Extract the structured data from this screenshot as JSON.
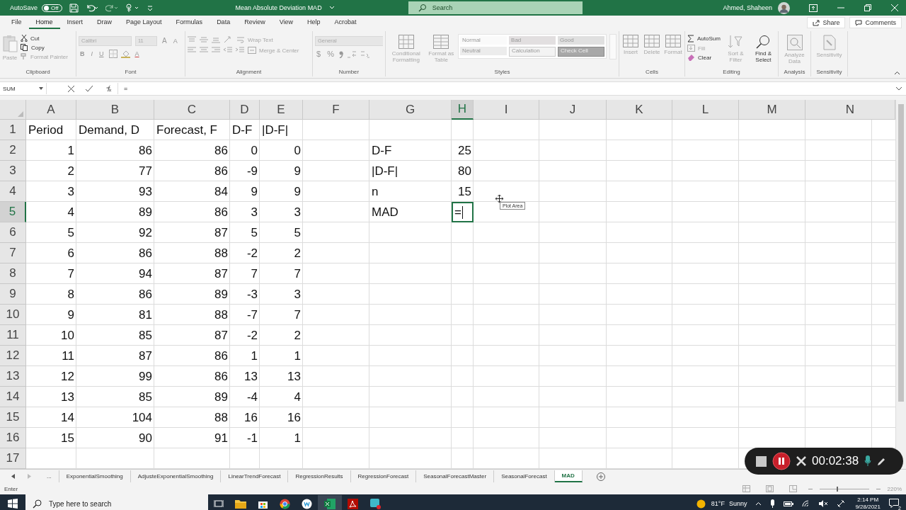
{
  "title_bar": {
    "autosave": {
      "label": "AutoSave",
      "on": false,
      "state_text": "Off"
    },
    "document_title": "Mean Absolute Deviation MAD",
    "search_placeholder": "Search",
    "user_name": "Ahmed, Shaheen"
  },
  "menu_tabs": [
    {
      "label": "File",
      "selected": false
    },
    {
      "label": "Home",
      "selected": true
    },
    {
      "label": "Insert",
      "selected": false
    },
    {
      "label": "Draw",
      "selected": false
    },
    {
      "label": "Page Layout",
      "selected": false
    },
    {
      "label": "Formulas",
      "selected": false
    },
    {
      "label": "Data",
      "selected": false
    },
    {
      "label": "Review",
      "selected": false
    },
    {
      "label": "View",
      "selected": false
    },
    {
      "label": "Help",
      "selected": false
    },
    {
      "label": "Acrobat",
      "selected": false
    }
  ],
  "share": "Share",
  "comments": "Comments",
  "ribbon": {
    "clipboard": {
      "label": "Clipboard",
      "paste": "Paste",
      "cut": "Cut",
      "copy": "Copy",
      "format_painter": "Format Painter"
    },
    "font": {
      "label": "Font",
      "font_name": "Calibri",
      "font_size": "11",
      "size_glyphs": [
        "A",
        "A"
      ],
      "format_glyphs": [
        "B",
        "I",
        "U"
      ],
      "font_color_glyph": "A"
    },
    "alignment": {
      "label": "Alignment",
      "wrap_text": "Wrap Text",
      "merge_center": "Merge & Center"
    },
    "number": {
      "label": "Number",
      "format": "General",
      "symbols": [
        "$",
        "%"
      ]
    },
    "styles": {
      "label": "Styles",
      "conditional_formatting": "Conditional Formatting",
      "format_as_table": "Format as Table",
      "cell_styles": [
        {
          "label": "Normal",
          "kind": "normal"
        },
        {
          "label": "Bad",
          "kind": "bad"
        },
        {
          "label": "Good",
          "kind": "good"
        },
        {
          "label": "Neutral",
          "kind": "neutral"
        },
        {
          "label": "Calculation",
          "kind": "calculation"
        },
        {
          "label": "Check Cell",
          "kind": "check"
        }
      ]
    },
    "cells": {
      "label": "Cells",
      "buttons": [
        "Insert",
        "Delete",
        "Format"
      ]
    },
    "editing": {
      "label": "Editing",
      "autosum": "AutoSum",
      "fill": "Fill",
      "clear": "Clear",
      "sort_filter": "Sort & Filter",
      "find_select": "Find & Select"
    },
    "analysis": {
      "label": "Analysis",
      "button": "Analyze Data"
    },
    "sensitivity": {
      "label": "Sensitivity",
      "button": "Sensitivity"
    }
  },
  "formula_bar": {
    "name_box": "SUM",
    "formula": "="
  },
  "sheet": {
    "columns": [
      {
        "label": "A",
        "selected": false
      },
      {
        "label": "B",
        "selected": false
      },
      {
        "label": "C",
        "selected": false
      },
      {
        "label": "D",
        "selected": false
      },
      {
        "label": "E",
        "selected": false
      },
      {
        "label": "F",
        "selected": false
      },
      {
        "label": "G",
        "selected": false
      },
      {
        "label": "H",
        "selected": true
      },
      {
        "label": "I",
        "selected": false
      },
      {
        "label": "J",
        "selected": false
      },
      {
        "label": "K",
        "selected": false
      },
      {
        "label": "L",
        "selected": false
      },
      {
        "label": "M",
        "selected": false
      },
      {
        "label": "N",
        "selected": false
      }
    ],
    "rows": [
      {
        "label": "1",
        "selected": false,
        "cells": [
          {
            "text": "Period",
            "kind": "text"
          },
          {
            "text": "Demand, D",
            "kind": "text"
          },
          {
            "text": "Forecast, F",
            "kind": "text"
          },
          {
            "text": "D-F",
            "kind": "text"
          },
          {
            "text": "|D-F|",
            "kind": "text"
          }
        ]
      },
      {
        "label": "2",
        "selected": false,
        "cells": [
          {
            "text": "1",
            "kind": "number"
          },
          {
            "text": "86",
            "kind": "number"
          },
          {
            "text": "86",
            "kind": "number"
          },
          {
            "text": "0",
            "kind": "number"
          },
          {
            "text": "0",
            "kind": "number"
          },
          {},
          {
            "text": "D-F",
            "kind": "text"
          },
          {
            "text": "25",
            "kind": "number"
          }
        ]
      },
      {
        "label": "3",
        "selected": false,
        "cells": [
          {
            "text": "2",
            "kind": "number"
          },
          {
            "text": "77",
            "kind": "number"
          },
          {
            "text": "86",
            "kind": "number"
          },
          {
            "text": "-9",
            "kind": "number"
          },
          {
            "text": "9",
            "kind": "number"
          },
          {},
          {
            "text": "|D-F|",
            "kind": "text"
          },
          {
            "text": "80",
            "kind": "number"
          }
        ]
      },
      {
        "label": "4",
        "selected": false,
        "cells": [
          {
            "text": "3",
            "kind": "number"
          },
          {
            "text": "93",
            "kind": "number"
          },
          {
            "text": "84",
            "kind": "number"
          },
          {
            "text": "9",
            "kind": "number"
          },
          {
            "text": "9",
            "kind": "number"
          },
          {},
          {
            "text": "n",
            "kind": "text"
          },
          {
            "text": "15",
            "kind": "number"
          }
        ]
      },
      {
        "label": "5",
        "selected": true,
        "cells": [
          {
            "text": "4",
            "kind": "number"
          },
          {
            "text": "89",
            "kind": "number"
          },
          {
            "text": "86",
            "kind": "number"
          },
          {
            "text": "3",
            "kind": "number"
          },
          {
            "text": "3",
            "kind": "number"
          },
          {},
          {
            "text": "MAD",
            "kind": "text"
          },
          {
            "text": "=",
            "kind": "text",
            "active": true
          }
        ]
      },
      {
        "label": "6",
        "selected": false,
        "cells": [
          {
            "text": "5",
            "kind": "number"
          },
          {
            "text": "92",
            "kind": "number"
          },
          {
            "text": "87",
            "kind": "number"
          },
          {
            "text": "5",
            "kind": "number"
          },
          {
            "text": "5",
            "kind": "number"
          }
        ]
      },
      {
        "label": "7",
        "selected": false,
        "cells": [
          {
            "text": "6",
            "kind": "number"
          },
          {
            "text": "86",
            "kind": "number"
          },
          {
            "text": "88",
            "kind": "number"
          },
          {
            "text": "-2",
            "kind": "number"
          },
          {
            "text": "2",
            "kind": "number"
          }
        ]
      },
      {
        "label": "8",
        "selected": false,
        "cells": [
          {
            "text": "7",
            "kind": "number"
          },
          {
            "text": "94",
            "kind": "number"
          },
          {
            "text": "87",
            "kind": "number"
          },
          {
            "text": "7",
            "kind": "number"
          },
          {
            "text": "7",
            "kind": "number"
          }
        ]
      },
      {
        "label": "9",
        "selected": false,
        "cells": [
          {
            "text": "8",
            "kind": "number"
          },
          {
            "text": "86",
            "kind": "number"
          },
          {
            "text": "89",
            "kind": "number"
          },
          {
            "text": "-3",
            "kind": "number"
          },
          {
            "text": "3",
            "kind": "number"
          }
        ]
      },
      {
        "label": "10",
        "selected": false,
        "cells": [
          {
            "text": "9",
            "kind": "number"
          },
          {
            "text": "81",
            "kind": "number"
          },
          {
            "text": "88",
            "kind": "number"
          },
          {
            "text": "-7",
            "kind": "number"
          },
          {
            "text": "7",
            "kind": "number"
          }
        ]
      },
      {
        "label": "11",
        "selected": false,
        "cells": [
          {
            "text": "10",
            "kind": "number"
          },
          {
            "text": "85",
            "kind": "number"
          },
          {
            "text": "87",
            "kind": "number"
          },
          {
            "text": "-2",
            "kind": "number"
          },
          {
            "text": "2",
            "kind": "number"
          }
        ]
      },
      {
        "label": "12",
        "selected": false,
        "cells": [
          {
            "text": "11",
            "kind": "number"
          },
          {
            "text": "87",
            "kind": "number"
          },
          {
            "text": "86",
            "kind": "number"
          },
          {
            "text": "1",
            "kind": "number"
          },
          {
            "text": "1",
            "kind": "number"
          }
        ]
      },
      {
        "label": "13",
        "selected": false,
        "cells": [
          {
            "text": "12",
            "kind": "number"
          },
          {
            "text": "99",
            "kind": "number"
          },
          {
            "text": "86",
            "kind": "number"
          },
          {
            "text": "13",
            "kind": "number"
          },
          {
            "text": "13",
            "kind": "number"
          }
        ]
      },
      {
        "label": "14",
        "selected": false,
        "cells": [
          {
            "text": "13",
            "kind": "number"
          },
          {
            "text": "85",
            "kind": "number"
          },
          {
            "text": "89",
            "kind": "number"
          },
          {
            "text": "-4",
            "kind": "number"
          },
          {
            "text": "4",
            "kind": "number"
          }
        ]
      },
      {
        "label": "15",
        "selected": false,
        "cells": [
          {
            "text": "14",
            "kind": "number"
          },
          {
            "text": "104",
            "kind": "number"
          },
          {
            "text": "88",
            "kind": "number"
          },
          {
            "text": "16",
            "kind": "number"
          },
          {
            "text": "16",
            "kind": "number"
          }
        ]
      },
      {
        "label": "16",
        "selected": false,
        "cells": [
          {
            "text": "15",
            "kind": "number"
          },
          {
            "text": "90",
            "kind": "number"
          },
          {
            "text": "91",
            "kind": "number"
          },
          {
            "text": "-1",
            "kind": "number"
          },
          {
            "text": "1",
            "kind": "number"
          }
        ]
      },
      {
        "label": "17",
        "selected": false,
        "cells": []
      }
    ]
  },
  "tooltip": "Plot Area",
  "sheet_tabs": {
    "overflow": "...",
    "tabs": [
      {
        "label": "ExponentialSmoothing",
        "selected": false
      },
      {
        "label": "AdjusteExponentialSmoothing",
        "selected": false
      },
      {
        "label": "LinearTrendForecast",
        "selected": false
      },
      {
        "label": "RegressionResults",
        "selected": false
      },
      {
        "label": "RegressionForecast",
        "selected": false
      },
      {
        "label": "SeasonalForecastMaster",
        "selected": false
      },
      {
        "label": "SeasonalForecast",
        "selected": false
      },
      {
        "label": "MAD",
        "selected": true
      }
    ]
  },
  "status_bar": {
    "mode": "Enter",
    "zoom": {
      "level": 0.35,
      "reading": "220%"
    }
  },
  "recorder": {
    "time": "00:02:38"
  },
  "taskbar": {
    "search_placeholder": "Type here to search",
    "temperature": "81°F",
    "weather": "Sunny",
    "time": "2:14 PM",
    "date": "9/28/2021",
    "notifications": "2"
  }
}
